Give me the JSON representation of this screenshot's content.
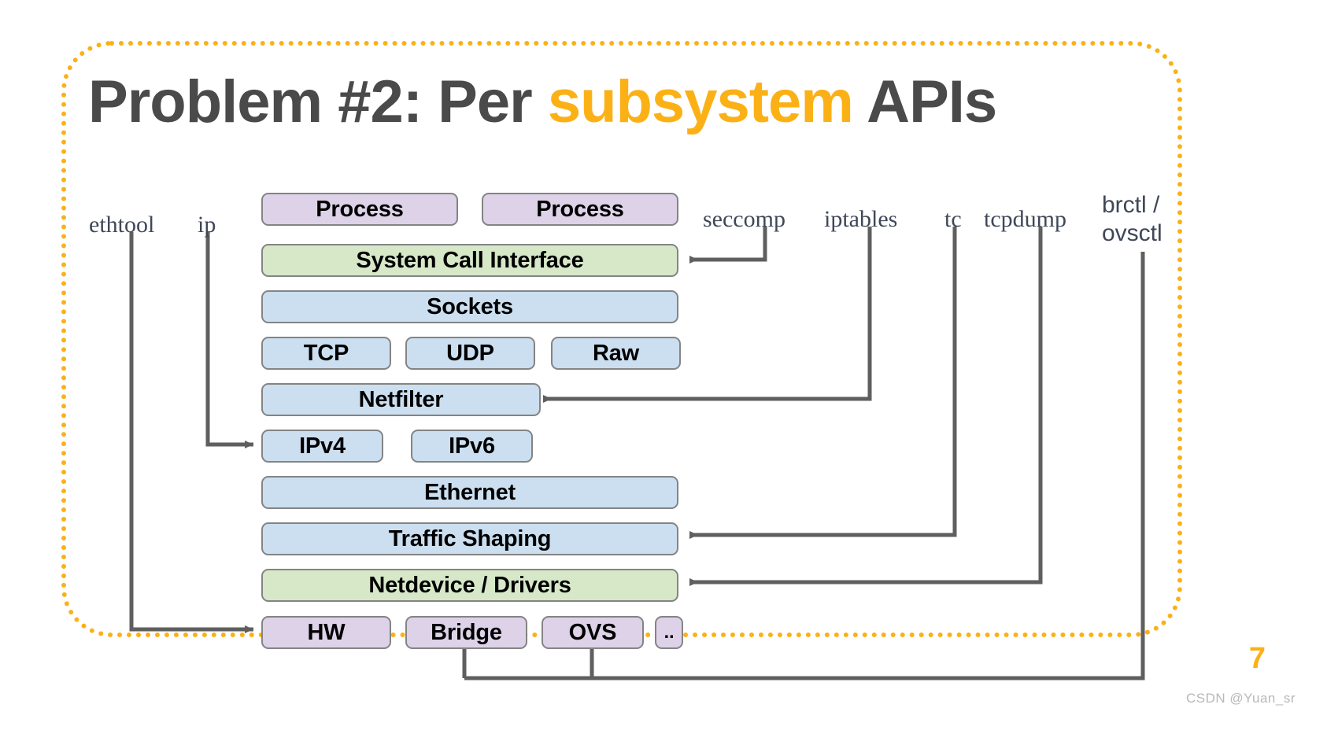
{
  "slide": {
    "title_part1": "Problem #2: Per ",
    "title_accent": "subsystem",
    "title_part2": " APIs",
    "page_number": "7",
    "watermark": "CSDN @Yuan_sr",
    "accent_color": "#FBB116",
    "title_color": "#4A4A4A",
    "frame_color": "#FBB116"
  },
  "tool_labels": [
    {
      "name": "ethtool",
      "text": "ethtool"
    },
    {
      "name": "ip",
      "text": "ip"
    },
    {
      "name": "seccomp",
      "text": "seccomp"
    },
    {
      "name": "iptables",
      "text": "iptables"
    },
    {
      "name": "tc",
      "text": "tc"
    },
    {
      "name": "tcpdump",
      "text": "tcpdump"
    },
    {
      "name": "brctl-ovsctl-line1",
      "text": "brctl /"
    },
    {
      "name": "brctl-ovsctl-line2",
      "text": "ovsctl"
    }
  ],
  "stack": {
    "rows": [
      {
        "row": "processes",
        "boxes": [
          {
            "label": "Process",
            "color": "purple"
          },
          {
            "label": "Process",
            "color": "purple"
          }
        ]
      },
      {
        "row": "syscall",
        "boxes": [
          {
            "label": "System Call Interface",
            "color": "green"
          }
        ]
      },
      {
        "row": "sockets",
        "boxes": [
          {
            "label": "Sockets",
            "color": "blue"
          }
        ]
      },
      {
        "row": "transport",
        "boxes": [
          {
            "label": "TCP",
            "color": "blue"
          },
          {
            "label": "UDP",
            "color": "blue"
          },
          {
            "label": "Raw",
            "color": "blue"
          }
        ]
      },
      {
        "row": "netfilter",
        "boxes": [
          {
            "label": "Netfilter",
            "color": "blue"
          }
        ]
      },
      {
        "row": "network",
        "boxes": [
          {
            "label": "IPv4",
            "color": "blue"
          },
          {
            "label": "IPv6",
            "color": "blue"
          }
        ]
      },
      {
        "row": "ethernet",
        "boxes": [
          {
            "label": "Ethernet",
            "color": "blue"
          }
        ]
      },
      {
        "row": "traffic",
        "boxes": [
          {
            "label": "Traffic Shaping",
            "color": "blue"
          }
        ]
      },
      {
        "row": "netdevice",
        "boxes": [
          {
            "label": "Netdevice / Drivers",
            "color": "green"
          }
        ]
      },
      {
        "row": "devices",
        "boxes": [
          {
            "label": "HW",
            "color": "purple"
          },
          {
            "label": "Bridge",
            "color": "purple"
          },
          {
            "label": "OVS",
            "color": "purple"
          },
          {
            "label": "..",
            "color": "purple"
          }
        ]
      }
    ],
    "colors": {
      "purple": "#DDD2E8",
      "green": "#D6E8C8",
      "blue": "#CBDFF0",
      "border": "#848484",
      "wire": "#5F5F5F"
    }
  },
  "connections": [
    {
      "from": "ethtool",
      "to": "HW"
    },
    {
      "from": "ip",
      "to": "IPv4"
    },
    {
      "from": "seccomp",
      "to": "System Call Interface"
    },
    {
      "from": "iptables",
      "to": "Netfilter"
    },
    {
      "from": "tc",
      "to": "Traffic Shaping"
    },
    {
      "from": "tcpdump",
      "to": "Netdevice / Drivers"
    },
    {
      "from": "brctl / ovsctl",
      "to": "Bridge"
    },
    {
      "from": "brctl / ovsctl",
      "to": "OVS"
    }
  ]
}
